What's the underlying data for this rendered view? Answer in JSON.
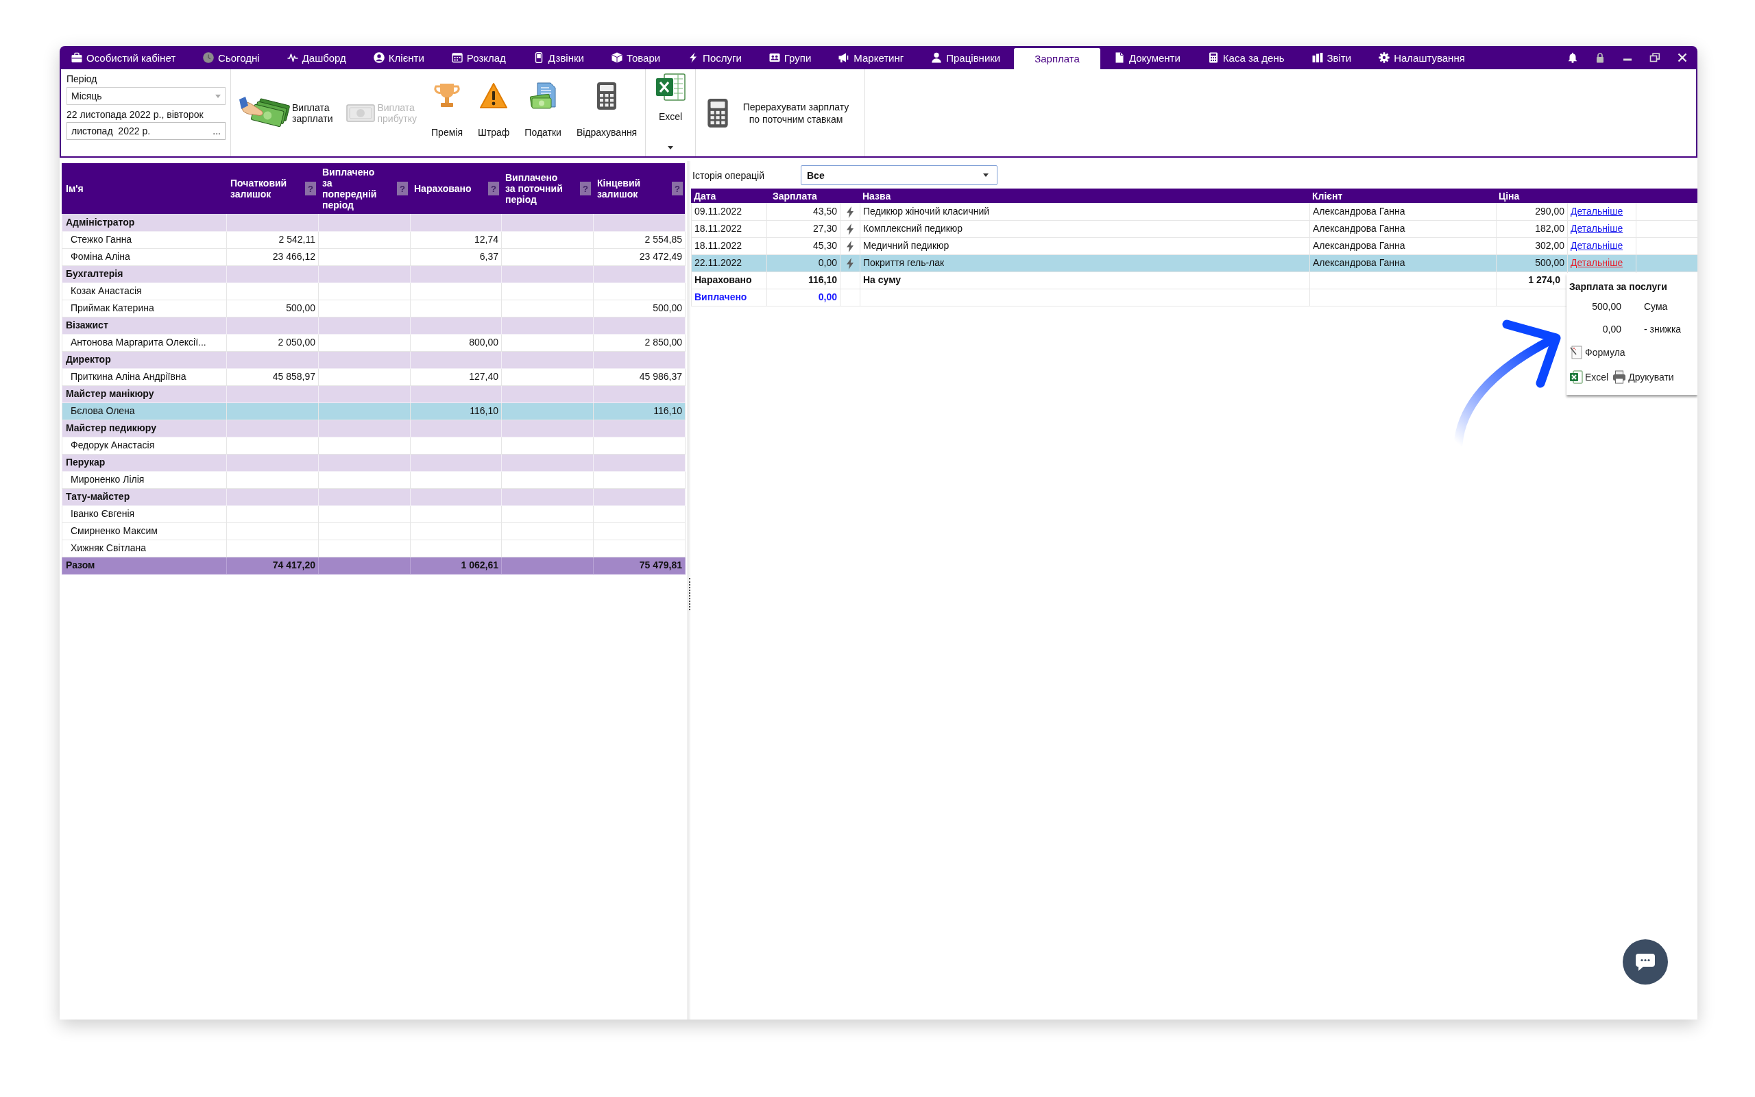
{
  "nav": {
    "items": [
      {
        "label": "Особистий кабінет",
        "selected": false
      },
      {
        "label": "Сьогодні",
        "selected": false
      },
      {
        "label": "Дашборд",
        "selected": false
      },
      {
        "label": "Клієнти",
        "selected": false
      },
      {
        "label": "Розклад",
        "selected": false
      },
      {
        "label": "Дзвінки",
        "selected": false
      },
      {
        "label": "Товари",
        "selected": false
      },
      {
        "label": "Послуги",
        "selected": false
      },
      {
        "label": "Групи",
        "selected": false
      },
      {
        "label": "Маркетинг",
        "selected": false
      },
      {
        "label": "Працівники",
        "selected": false
      },
      {
        "label": "Зарплата",
        "selected": true
      },
      {
        "label": "Документи",
        "selected": false
      },
      {
        "label": "Каса за день",
        "selected": false
      },
      {
        "label": "Звіти",
        "selected": false
      },
      {
        "label": "Налаштування",
        "selected": false
      }
    ]
  },
  "toolbar": {
    "period": {
      "label": "Період",
      "value": "Місяць",
      "date_text": "22 листопада 2022 р., вівторок",
      "month_value": "листопад  2022 р.",
      "picker": "..."
    },
    "buttons": [
      {
        "label": "Виплата зарплати",
        "kind": "inline",
        "disabled": false
      },
      {
        "label": "Виплата прибутку",
        "kind": "inline",
        "disabled": true
      },
      {
        "label": "Премія",
        "kind": "stacked",
        "disabled": false
      },
      {
        "label": "Штраф",
        "kind": "stacked",
        "disabled": false
      },
      {
        "label": "Податки",
        "kind": "stacked",
        "disabled": false
      },
      {
        "label": "Відрахування",
        "kind": "stacked",
        "disabled": false
      }
    ],
    "export": {
      "label": "Excel"
    },
    "recalculate": {
      "label": "Перерахувати зарплату по поточним ставкам"
    }
  },
  "staff_table": {
    "columns": [
      {
        "label": "Ім'я"
      },
      {
        "label": "Початковий залишок",
        "help": "?"
      },
      {
        "label": "Виплачено за попередній період",
        "help": "?"
      },
      {
        "label": "Нараховано",
        "help": "?"
      },
      {
        "label": "Виплачено за поточний період",
        "help": "?"
      },
      {
        "label": "Кінцевий залишок",
        "help": "?"
      }
    ],
    "groups": [
      {
        "name": "Адміністратор",
        "selected": false,
        "children": [
          {
            "name": "Стежко Ганна",
            "selected": false,
            "initial_balance": "2 542,11",
            "accrued": "12,74",
            "final_balance": "2 554,85"
          },
          {
            "name": "Фоміна Аліна",
            "selected": false,
            "initial_balance": "23 466,12",
            "accrued": "6,37",
            "final_balance": "23 472,49"
          }
        ]
      },
      {
        "name": "Бухгалтерія",
        "selected": false,
        "children": [
          {
            "name": "Козак Анастасія",
            "selected": false
          },
          {
            "name": "Приймак Катерина",
            "selected": false,
            "initial_balance": "500,00",
            "final_balance": "500,00"
          }
        ]
      },
      {
        "name": "Візажист",
        "selected": false,
        "children": [
          {
            "name": "Антонова Маргарита Олексії...",
            "selected": false,
            "initial_balance": "2 050,00",
            "accrued": "800,00",
            "final_balance": "2 850,00"
          }
        ]
      },
      {
        "name": "Директор",
        "selected": false,
        "children": [
          {
            "name": "Приткина Аліна Андріївна",
            "selected": false,
            "initial_balance": "45 858,97",
            "accrued": "127,40",
            "final_balance": "45 986,37"
          }
        ]
      },
      {
        "name": "Майстер манікюру",
        "selected": false,
        "children": [
          {
            "name": "Бєлова Олена",
            "selected": true,
            "accrued": "116,10",
            "final_balance": "116,10"
          }
        ]
      },
      {
        "name": "Майстер педикюру",
        "selected": false,
        "children": [
          {
            "name": "Федорук Анастасія",
            "selected": false
          }
        ]
      },
      {
        "name": "Перукар",
        "selected": false,
        "children": [
          {
            "name": "Мироненко Лілія",
            "selected": false
          }
        ]
      },
      {
        "name": "Тату-майстер",
        "selected": false,
        "children": [
          {
            "name": "Іванко Євгенія",
            "selected": false
          },
          {
            "name": "Смирненко Максим",
            "selected": false
          },
          {
            "name": "Хижняк Світлана",
            "selected": false
          }
        ]
      }
    ],
    "total": {
      "label": "Разом",
      "initial_balance": "74 417,20",
      "accrued": "1 062,61",
      "final_balance": "75 479,81"
    }
  },
  "operations": {
    "filter": {
      "label": "Історія операцій",
      "value": "Все"
    },
    "columns": [
      {
        "label": "Дата"
      },
      {
        "label": "Зарплата"
      },
      {
        "label": "Назва"
      },
      {
        "label": "Клієнт"
      },
      {
        "label": "Ціна"
      }
    ],
    "rows": [
      {
        "date": "09.11.2022",
        "salary": "43,50",
        "service": "Педикюр жіночий класичний",
        "client": "Александрова Ганна",
        "price": "290,00",
        "link": "Детальніше",
        "selected": false
      },
      {
        "date": "18.11.2022",
        "salary": "27,30",
        "service": "Комплексний педикюр",
        "client": "Александрова Ганна",
        "price": "182,00",
        "link": "Детальніше",
        "selected": false
      },
      {
        "date": "18.11.2022",
        "salary": "45,30",
        "service": "Медичний педикюр",
        "client": "Александрова Ганна",
        "price": "302,00",
        "link": "Детальніше",
        "selected": false
      },
      {
        "date": "22.11.2022",
        "salary": "0,00",
        "service": "Покриття гель-лак",
        "client": "Александрова Ганна",
        "price": "500,00",
        "link": "Детальніше",
        "selected": true
      }
    ],
    "accrued": {
      "label": "Нараховано",
      "value": "116,10",
      "sum_label": "На суму",
      "sum_value": "1 274,0"
    },
    "paid": {
      "label": "Виплачено",
      "value": "0,00"
    }
  },
  "popup": {
    "title": "Зарплата за послуги",
    "lines": [
      {
        "value": "500,00",
        "label": "Сума"
      },
      {
        "value": "0,00",
        "label": "- знижка"
      }
    ],
    "formula": "Формула",
    "excel": "Excel",
    "print": "Друкувати"
  }
}
